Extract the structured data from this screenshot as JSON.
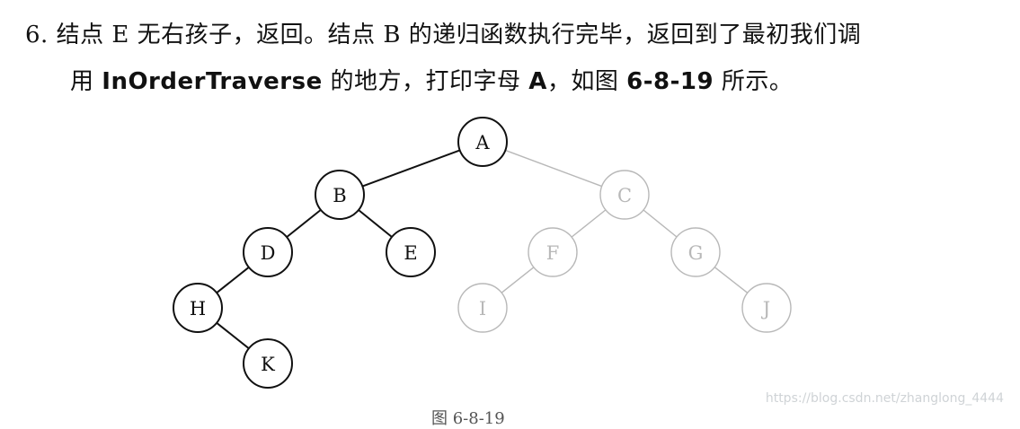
{
  "paragraph": {
    "number": "6.",
    "line1": "结点 E 无右孩子，返回。结点 B 的递归函数执行完毕，返回到了最初我们调",
    "line2_pre": "用 ",
    "line2_func": "InOrderTraverse",
    "line2_mid": " 的地方，打印字母 ",
    "line2_letter": "A",
    "line2_sep": "，如图 ",
    "line2_fig": "6-8-19",
    "line2_post": " 所示。"
  },
  "tree": {
    "nodes": [
      {
        "id": "A",
        "state": "visited"
      },
      {
        "id": "B",
        "state": "visited"
      },
      {
        "id": "C",
        "state": "faded"
      },
      {
        "id": "D",
        "state": "visited"
      },
      {
        "id": "E",
        "state": "visited"
      },
      {
        "id": "F",
        "state": "faded"
      },
      {
        "id": "G",
        "state": "faded"
      },
      {
        "id": "H",
        "state": "visited"
      },
      {
        "id": "I",
        "state": "faded"
      },
      {
        "id": "J",
        "state": "faded"
      },
      {
        "id": "K",
        "state": "visited"
      }
    ],
    "edges": [
      [
        "A",
        "B"
      ],
      [
        "A",
        "C"
      ],
      [
        "B",
        "D"
      ],
      [
        "B",
        "E"
      ],
      [
        "C",
        "F"
      ],
      [
        "C",
        "G"
      ],
      [
        "D",
        "H"
      ],
      [
        "H",
        "K"
      ],
      [
        "F",
        "I"
      ],
      [
        "G",
        "J"
      ]
    ],
    "colors": {
      "visited": "#111111",
      "faded": "#b8b8b8",
      "fill": "#ffffff"
    }
  },
  "watermark": "https://blog.csdn.net/zhanglong_4444",
  "caption": "图 6-8-19"
}
